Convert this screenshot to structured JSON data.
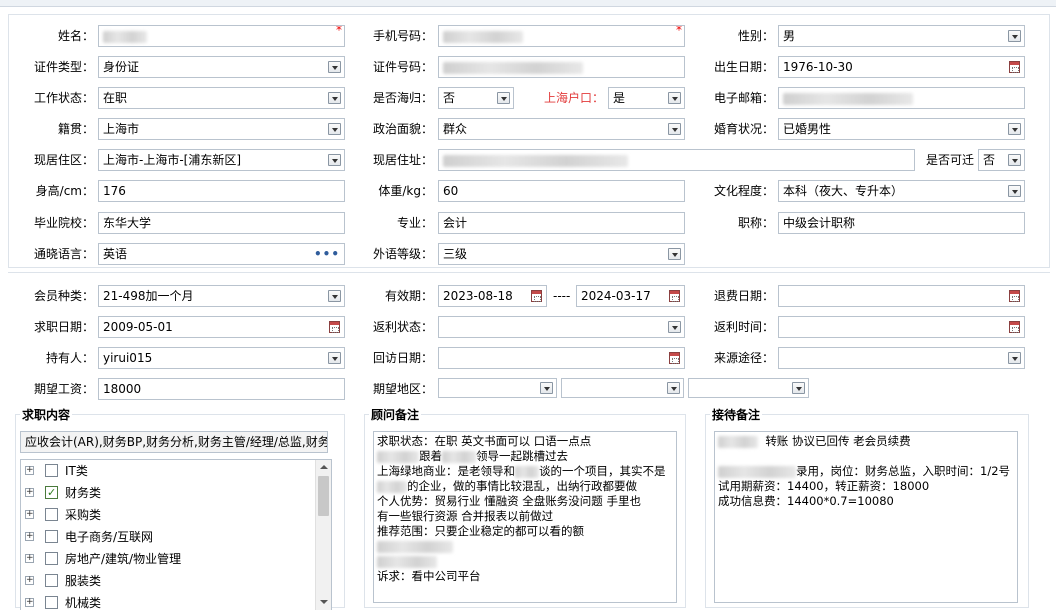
{
  "personal": {
    "name_label": "姓名：",
    "phone_label": "手机号码：",
    "gender_label": "性别：",
    "gender_value": "男",
    "idtype_label": "证件类型：",
    "idtype_value": "身份证",
    "idno_label": "证件号码：",
    "birth_label": "出生日期：",
    "birth_value": "1976-10-30",
    "workstatus_label": "工作状态：",
    "workstatus_value": "在职",
    "returnee_label": "是否海归：",
    "returnee_value": "否",
    "hukou_label": "上海户口：",
    "hukou_value": "是",
    "email_label": "电子邮箱：",
    "origin_label": "籍贯：",
    "origin_value": "上海市",
    "political_label": "政治面貌：",
    "political_value": "群众",
    "marital_label": "婚育状况：",
    "marital_value": "已婚男性",
    "residence_label": "现居住区：",
    "residence_value": "上海市-上海市-[浦东新区]",
    "address_label": "现居住址：",
    "relocate_label": "是否可迁",
    "relocate_value": "否",
    "height_label": "身高/cm：",
    "height_value": "176",
    "weight_label": "体重/kg：",
    "weight_value": "60",
    "education_label": "文化程度：",
    "education_value": "本科（夜大、专升本）",
    "school_label": "毕业院校：",
    "school_value": "东华大学",
    "major_label": "专业：",
    "major_value": "会计",
    "title_label": "职称：",
    "title_value": "中级会计职称",
    "language_label": "通晓语言：",
    "language_value": "英语",
    "language_more": "•••",
    "langlevel_label": "外语等级：",
    "langlevel_value": "三级"
  },
  "membership": {
    "type_label": "会员种类：",
    "type_value": "21-498加一个月",
    "valid_label": "有效期：",
    "valid_from": "2023-08-18",
    "valid_sep": "----",
    "valid_to": "2024-03-17",
    "refund_label": "退费日期：",
    "jobdate_label": "求职日期：",
    "jobdate_value": "2009-05-01",
    "rebatestatus_label": "返利状态：",
    "rebatetime_label": "返利时间：",
    "holder_label": "持有人：",
    "holder_value": "yirui015",
    "visit_label": "回访日期：",
    "source_label": "来源途径：",
    "salary_label": "期望工资：",
    "salary_value": "18000",
    "region_label": "期望地区："
  },
  "job_intent": {
    "title": "求职内容",
    "summary": "应收会计(AR),财务BP,财务分析,财务主管/经理/总监,财务",
    "items": [
      {
        "label": "IT类",
        "checked": false
      },
      {
        "label": "财务类",
        "checked": true
      },
      {
        "label": "采购类",
        "checked": false
      },
      {
        "label": "电子商务/互联网",
        "checked": false
      },
      {
        "label": "房地产/建筑/物业管理",
        "checked": false
      },
      {
        "label": "服装类",
        "checked": false
      },
      {
        "label": "机械类",
        "checked": false
      }
    ]
  },
  "consultant_notes": {
    "title": "顾问备注",
    "line1": "求职状态：在职  英文书面可以  口语一点点",
    "line2a": "跟着",
    "line2b": "领导一起跳槽过去",
    "line3a": "上海绿地商业：是老领导和",
    "line3b": "谈的一个项目，其实不是",
    "line4": "的企业，做的事情比较混乱，出纳行政都要做",
    "line5": "个人优势：贸易行业  懂融资  全盘账务没问题  手里也",
    "line6": "有一些银行资源  合并报表以前做过",
    "line7": "推荐范围：只要企业稳定的都可以看的额",
    "line8": "诉求：看中公司平台"
  },
  "reception_notes": {
    "title": "接待备注",
    "line1": "转账   协议已回传   老会员续费",
    "line2": "录用，岗位：财务总监，入职时间：1/2号",
    "line3": "试用期薪资：14400，转正薪资：18000",
    "line4": "成功信息费：14400*0.7=10080"
  },
  "colors": {
    "required": "#e00000",
    "hukou_label": "#e23b3b",
    "border": "#b9c3ce"
  }
}
